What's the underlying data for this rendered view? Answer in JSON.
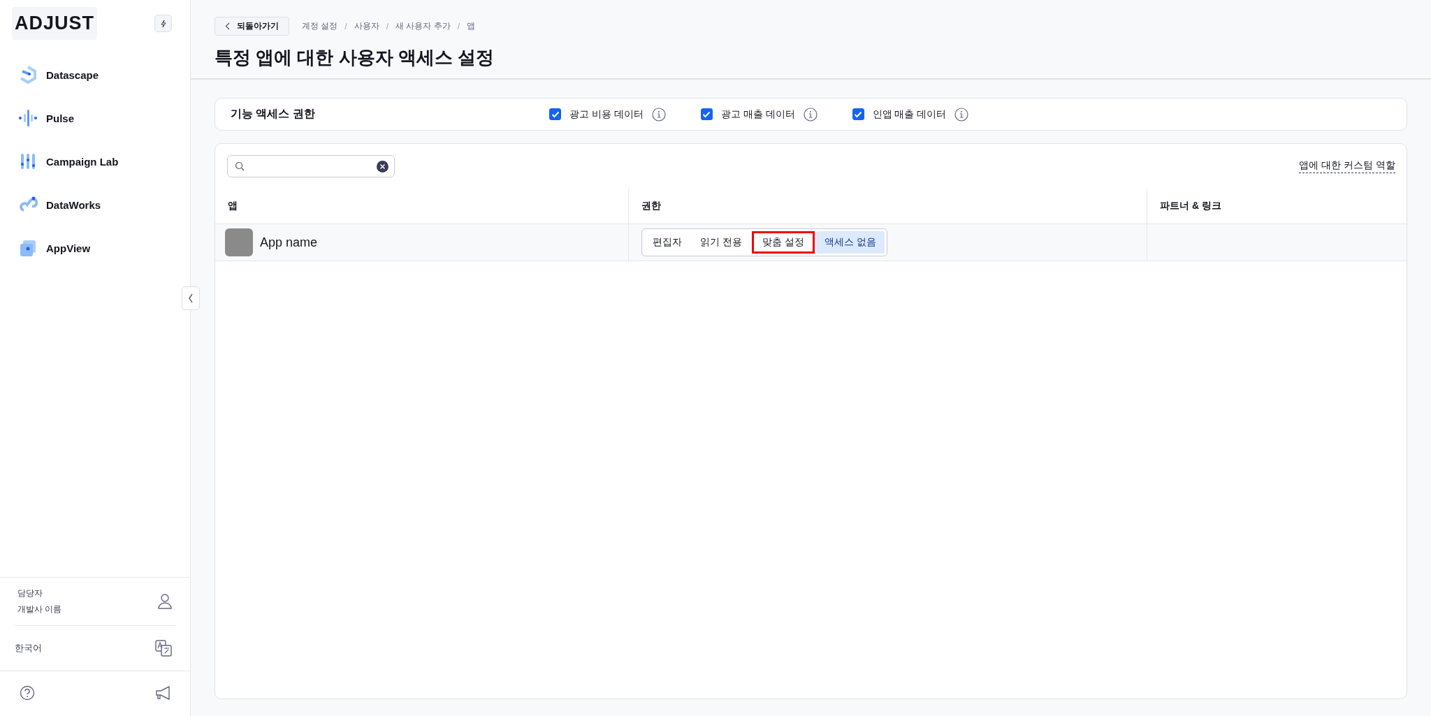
{
  "sidebar": {
    "logo": "ADJUST",
    "nav": [
      {
        "label": "Datascape"
      },
      {
        "label": "Pulse"
      },
      {
        "label": "Campaign Lab"
      },
      {
        "label": "DataWorks"
      },
      {
        "label": "AppView"
      }
    ],
    "user": {
      "role": "담당자",
      "name": "개발사 이름"
    },
    "language": "한국어"
  },
  "header": {
    "back": "되돌아가기",
    "breadcrumb_separator": "/",
    "breadcrumbs": [
      "계정 설정",
      "사용자",
      "새 사용자 추가",
      "앱"
    ],
    "title": "특정 앱에 대한 사용자 액세스 설정"
  },
  "feature_access": {
    "label": "기능 액세스 권한",
    "options": [
      {
        "label": "광고 비용 데이터",
        "checked": true
      },
      {
        "label": "광고 매출 데이터",
        "checked": true
      },
      {
        "label": "인앱 매출 데이터",
        "checked": true
      }
    ]
  },
  "table": {
    "custom_role_link": "앱에 대한 커스텀 역할",
    "columns": [
      "앱",
      "권한",
      "파트너 & 링크"
    ],
    "rows": [
      {
        "app": "App name",
        "permissions": [
          {
            "label": "편집자",
            "selected": false,
            "highlighted": false
          },
          {
            "label": "읽기 전용",
            "selected": false,
            "highlighted": false
          },
          {
            "label": "맞춤 설정",
            "selected": false,
            "highlighted": true
          },
          {
            "label": "액세스 없음",
            "selected": true,
            "highlighted": false
          }
        ]
      }
    ]
  }
}
